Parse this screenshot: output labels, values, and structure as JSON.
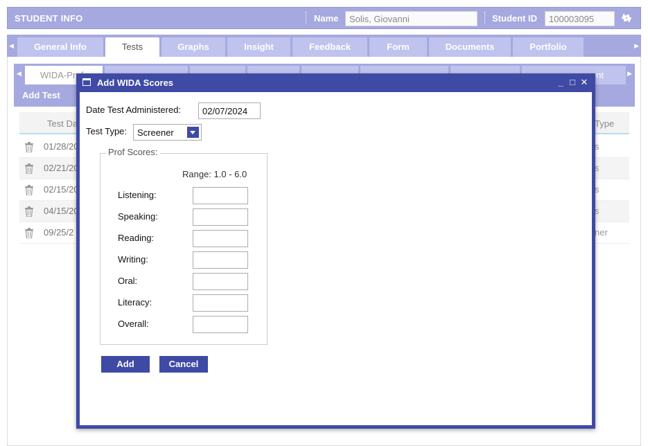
{
  "header": {
    "title": "STUDENT INFO",
    "name_label": "Name",
    "name_value": "Solis, Giovanni",
    "id_label": "Student ID",
    "id_value": "100003095"
  },
  "tabs": [
    "General Info",
    "Tests",
    "Graphs",
    "Insight",
    "Feedback",
    "Form",
    "Documents",
    "Portfolio"
  ],
  "active_tab": "Tests",
  "sub_tabs": {
    "first_visible": "WIDA-Prof",
    "last_visible": "ent"
  },
  "add_test_label": "Add Test",
  "grid": {
    "header_date": "Test Da",
    "header_type": "Type",
    "rows": [
      {
        "date": "01/28/20",
        "type": "s"
      },
      {
        "date": "02/21/20",
        "type": "s"
      },
      {
        "date": "02/15/20",
        "type": "s"
      },
      {
        "date": "04/15/20",
        "type": "s"
      },
      {
        "date": "09/25/2",
        "type": "ner"
      }
    ]
  },
  "dialog": {
    "title": "Add WIDA Scores",
    "date_label": "Date Test Administered:",
    "date_value": "02/07/2024",
    "type_label": "Test Type:",
    "type_value": "Screener",
    "prof_legend": "Prof Scores:",
    "range": "Range: 1.0 - 6.0",
    "scores": [
      {
        "label": "Listening:",
        "value": ""
      },
      {
        "label": "Speaking:",
        "value": ""
      },
      {
        "label": "Reading:",
        "value": ""
      },
      {
        "label": "Writing:",
        "value": ""
      },
      {
        "label": "Oral:",
        "value": ""
      },
      {
        "label": "Literacy:",
        "value": ""
      },
      {
        "label": "Overall:",
        "value": ""
      }
    ],
    "add_label": "Add",
    "cancel_label": "Cancel"
  },
  "colors": {
    "header_bg": "#a5a9df",
    "tab_bg": "#bfc3ee",
    "dialog_accent": "#3f4aa5"
  },
  "icons": [
    "swap-icon",
    "trash-icon",
    "window-icon",
    "minimize-icon",
    "maximize-icon",
    "close-icon",
    "scroll-left-icon",
    "scroll-right-icon",
    "dropdown-caret-icon"
  ]
}
